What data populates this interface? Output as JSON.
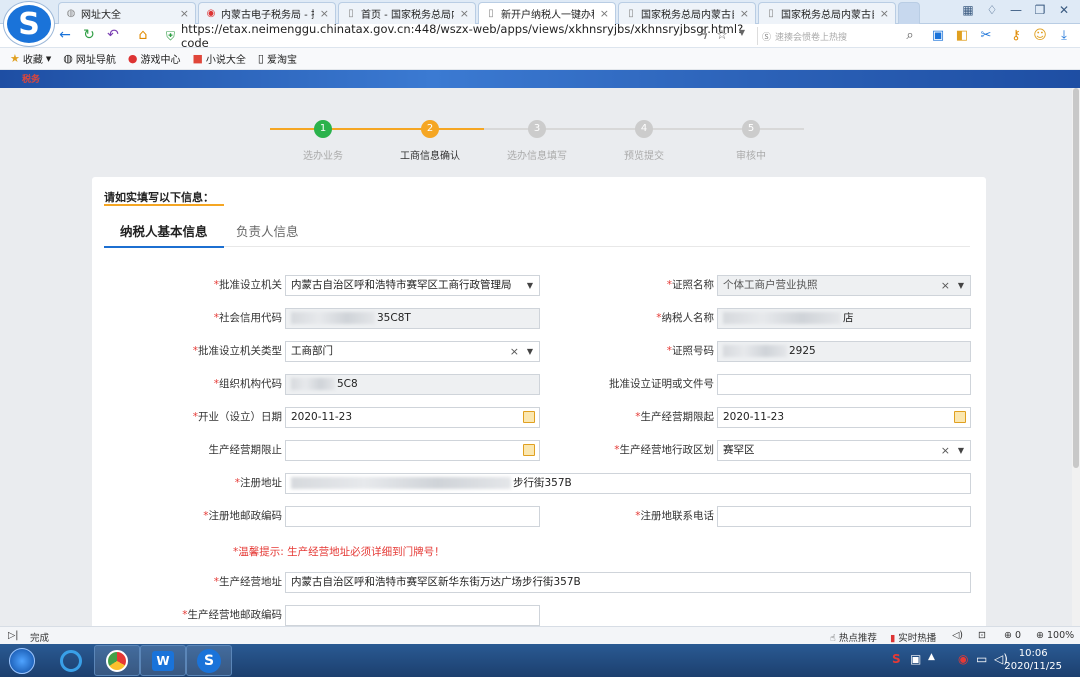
{
  "browser": {
    "tabs": [
      {
        "title": "网址大全",
        "icon": "globe-icon",
        "active": false
      },
      {
        "title": "内蒙古电子税务局 - 搜",
        "icon": "search-engine-icon",
        "active": false
      },
      {
        "title": "首页 - 国家税务总局内蒙",
        "icon": "page-icon",
        "active": false
      },
      {
        "title": "新开户纳税人一键办税",
        "icon": "page-icon",
        "active": true
      },
      {
        "title": "国家税务总局内蒙古自",
        "icon": "page-icon",
        "active": false
      },
      {
        "title": "国家税务总局内蒙古自",
        "icon": "page-icon",
        "active": false
      }
    ],
    "url": "https://etax.neimenggu.chinatax.gov.cn:448/wszx-web/apps/views/xkhnsryjbs/xkhnsryjbsgr.html?code",
    "search_placeholder": "速揍会惯卷上热搜",
    "bookmarks": [
      {
        "label": "收藏",
        "icon": "star-icon"
      },
      {
        "label": "网址导航",
        "icon": "globe-icon"
      },
      {
        "label": "游戏中心",
        "icon": "game-icon"
      },
      {
        "label": "小说大全",
        "icon": "book-icon"
      },
      {
        "label": "爱淘宝",
        "icon": "page-icon"
      }
    ]
  },
  "site": {
    "banner_text": "税务"
  },
  "steps": [
    {
      "num": "1",
      "label": "选办业务",
      "state": "done"
    },
    {
      "num": "2",
      "label": "工商信息确认",
      "state": "current"
    },
    {
      "num": "3",
      "label": "选办信息填写",
      "state": "todo"
    },
    {
      "num": "4",
      "label": "预览提交",
      "state": "todo"
    },
    {
      "num": "5",
      "label": "审核中",
      "state": "todo"
    }
  ],
  "form": {
    "title": "请如实填写以下信息：",
    "tabs": [
      "纳税人基本信息",
      "负责人信息"
    ],
    "left": [
      {
        "label": "批准设立机关",
        "required": true,
        "value": "内蒙古自治区呼和浩特市赛罕区工商行政管理局",
        "kind": "select"
      },
      {
        "label": "社会信用代码",
        "required": true,
        "value": "35C8T",
        "kind": "readonly"
      },
      {
        "label": "批准设立机关类型",
        "required": true,
        "value": "工商部门",
        "kind": "select-clear"
      },
      {
        "label": "组织机构代码",
        "required": true,
        "value": "5C8",
        "kind": "readonly"
      },
      {
        "label": "开业（设立）日期",
        "required": true,
        "value": "2020-11-23",
        "kind": "date"
      },
      {
        "label": "生产经营期限止",
        "required": false,
        "value": "",
        "kind": "date"
      }
    ],
    "right": [
      {
        "label": "证照名称",
        "required": true,
        "value": "个体工商户营业执照",
        "kind": "readonly-select"
      },
      {
        "label": "纳税人名称",
        "required": true,
        "value": "店",
        "kind": "readonly"
      },
      {
        "label": "证照号码",
        "required": true,
        "value": "2925",
        "kind": "readonly"
      },
      {
        "label": "批准设立证明或文件号",
        "required": false,
        "value": "",
        "kind": "text"
      },
      {
        "label": "生产经营期限起",
        "required": true,
        "value": "2020-11-23",
        "kind": "date"
      },
      {
        "label": "生产经营地行政区划",
        "required": true,
        "value": "赛罕区",
        "kind": "select-clear"
      }
    ],
    "reg_address": {
      "label": "注册地址",
      "required": true,
      "value": "步行街357B"
    },
    "reg_postcode": {
      "label": "注册地邮政编码",
      "required": true,
      "value": ""
    },
    "reg_phone": {
      "label": "注册地联系电话",
      "required": true,
      "value": ""
    },
    "warning": "*温馨提示: 生产经营地址必须详细到门牌号！",
    "biz_address": {
      "label": "生产经营地址",
      "required": true,
      "value": "内蒙古自治区呼和浩特市赛罕区新华东街万达广场步行街357B"
    },
    "biz_postcode": {
      "label": "生产经营地邮政编码",
      "required": true,
      "value": ""
    }
  },
  "status": {
    "text": "完成",
    "hot_label": "热点推荐",
    "live_label": "实时热播",
    "download_count": "0",
    "zoom": "100%"
  },
  "clock": {
    "time": "10:06",
    "date": "2020/11/25"
  }
}
